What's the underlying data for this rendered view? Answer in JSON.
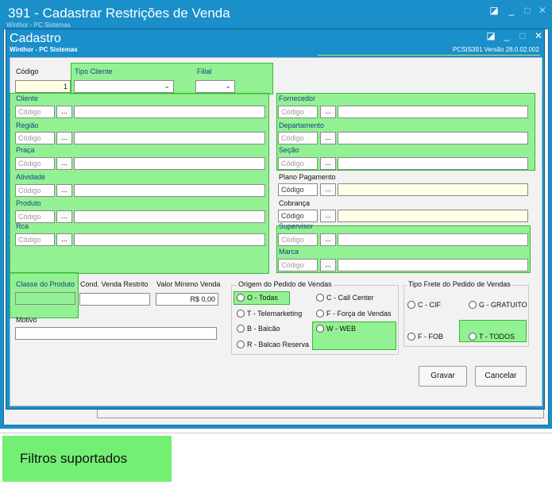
{
  "outer_window": {
    "title": "391 - Cadastrar Restrições de Venda",
    "subtitle": "Winthor - PC Sistemas"
  },
  "inner_window": {
    "title": "Cadastro",
    "subtitle": "Winthor - PC Sistemas",
    "version": "PCSIS391  Versão  28.0.02.002"
  },
  "window_controls": {
    "restore": "◪",
    "minimize": "_",
    "maximize": "□",
    "close": "✕"
  },
  "fields": {
    "codigo_label": "Código",
    "codigo_value": "1",
    "tipo_cliente_label": "Tipo Cliente",
    "filial_label": "Filial",
    "lookup_placeholder": "Código",
    "lookup_button": "...",
    "cliente_label": "Cliente",
    "regiao_label": "Região",
    "praca_label": "Praça",
    "atividade_label": "Atividade",
    "produto_label": "Produto",
    "rca_label": "Rca",
    "fornecedor_label": "Fornecedor",
    "departamento_label": "Departamento",
    "secao_label": "Seção",
    "plano_pagamento_label": "Plano Pagamento",
    "cobranca_label": "Cobrança",
    "supervisor_label": "Supervisor",
    "marca_label": "Marca",
    "classe_produto_label": "Classe do Produto",
    "cond_venda_label": "Cond. Venda Restrito",
    "valor_minimo_label": "Valor Mínimo Venda",
    "valor_minimo_value": "R$ 0,00",
    "motivo_label": "Motivo"
  },
  "origem": {
    "title": "Origem do Pedido de Vendas",
    "options": [
      "O - Todas",
      "C - Call Center",
      "T - Telemarketing",
      "F - Força de Vendas",
      "B - Balcão",
      "W - WEB",
      "R - Balcao Reserva"
    ]
  },
  "frete": {
    "title": "Tipo Frete do Pedido de Vendas",
    "options": [
      "C - CIF",
      "G - GRATUITO",
      "F - FOB",
      "T - TODOS"
    ]
  },
  "buttons": {
    "gravar": "Gravar",
    "cancelar": "Cancelar"
  },
  "caption": "Filtros suportados",
  "colors": {
    "titlebar": "#1a8fc9",
    "highlight": "#6cf06c"
  }
}
